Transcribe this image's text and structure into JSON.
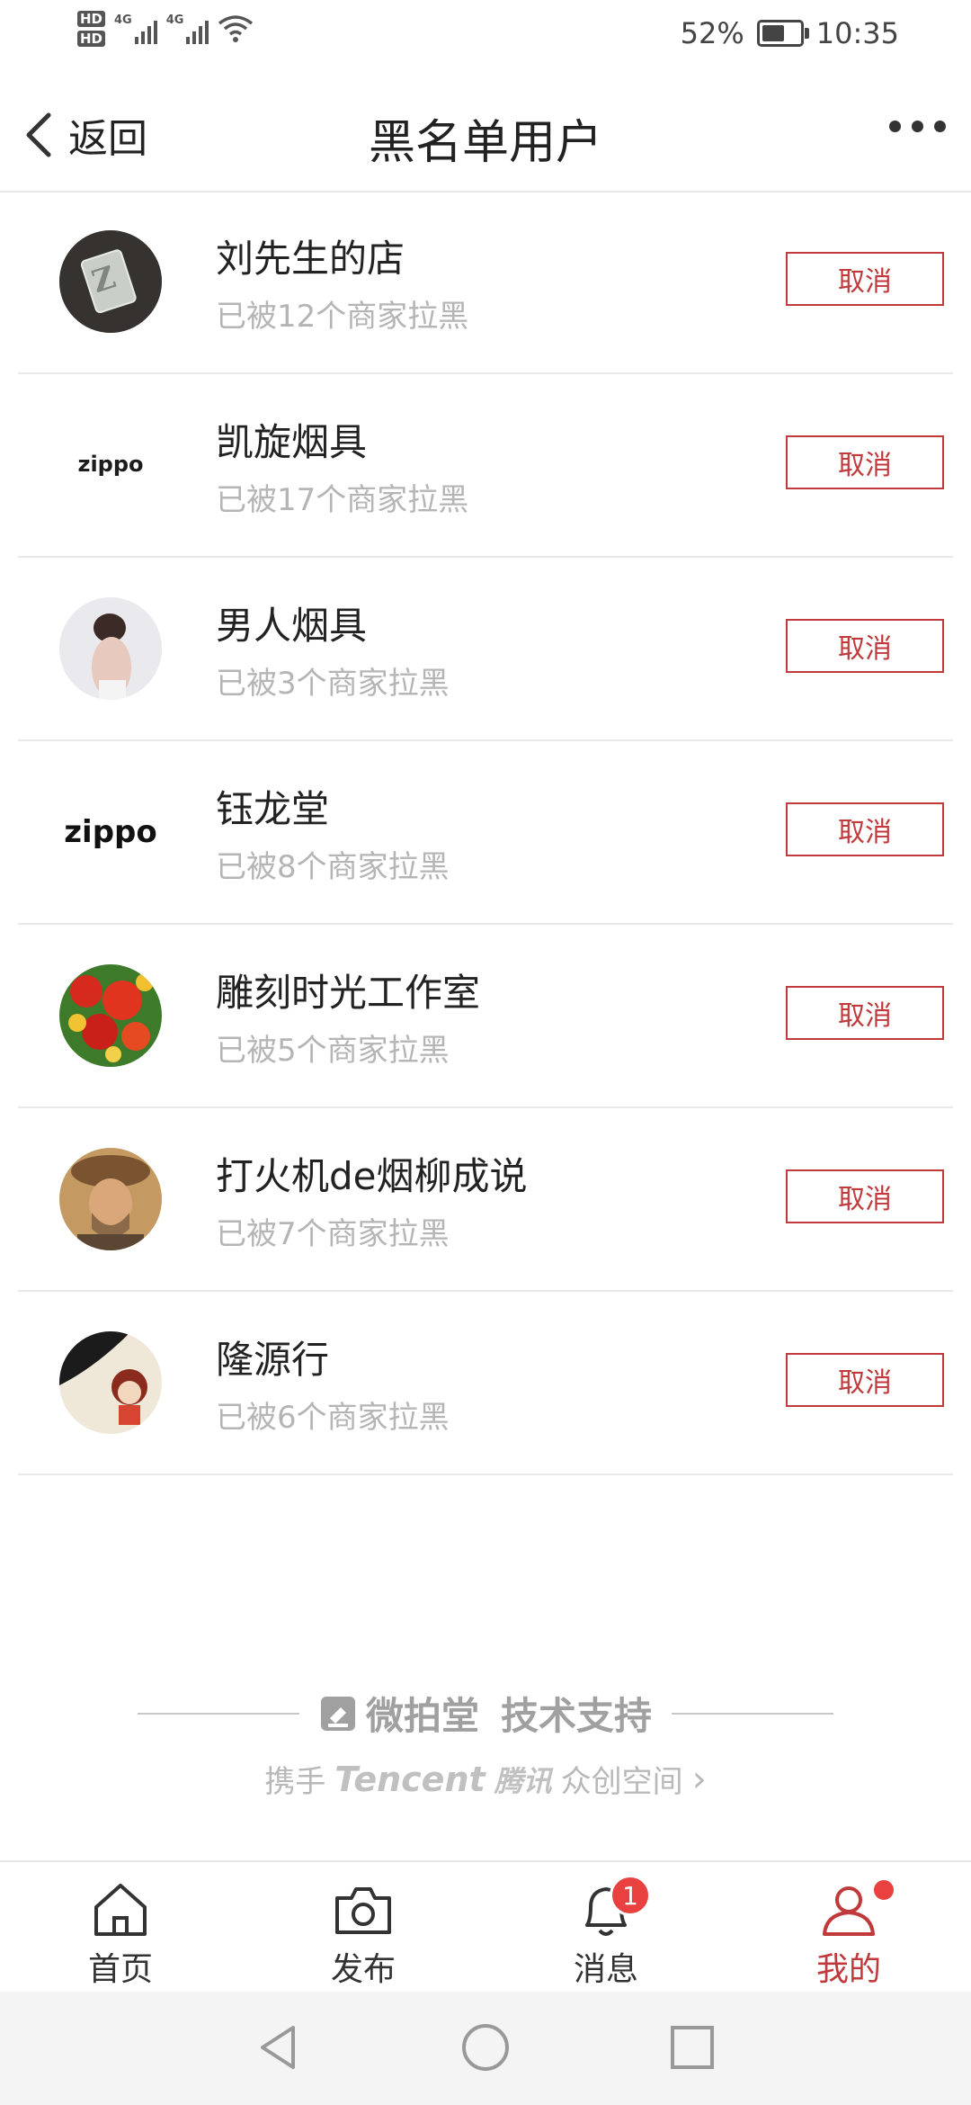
{
  "status_bar": {
    "hd1": "HD",
    "hd2": "HD",
    "net1": "4G",
    "net2": "4G",
    "battery_percent": "52%",
    "time": "10:35"
  },
  "header": {
    "back_label": "返回",
    "title": "黑名单用户"
  },
  "users": [
    {
      "name": "刘先生的店",
      "blocked_text": "已被12个商家拉黑",
      "action": "取消"
    },
    {
      "name": "凯旋烟具",
      "blocked_text": "已被17个商家拉黑",
      "action": "取消"
    },
    {
      "name": "男人烟具",
      "blocked_text": "已被3个商家拉黑",
      "action": "取消"
    },
    {
      "name": "钰龙堂",
      "blocked_text": "已被8个商家拉黑",
      "action": "取消"
    },
    {
      "name": "雕刻时光工作室",
      "blocked_text": "已被5个商家拉黑",
      "action": "取消"
    },
    {
      "name": "打火机de烟柳成说",
      "blocked_text": "已被7个商家拉黑",
      "action": "取消"
    },
    {
      "name": "隆源行",
      "blocked_text": "已被6个商家拉黑",
      "action": "取消"
    }
  ],
  "avatars": {
    "zippo_small": "zippo",
    "zippo_large": "zippo"
  },
  "credit": {
    "brand": "微拍堂",
    "support": "技术支持",
    "prefix": "携手",
    "tencent": "Tencent",
    "tencent_cn": "腾讯",
    "suffix": "众创空间",
    "chevron": "›"
  },
  "tabs": [
    {
      "label": "首页",
      "icon": "home-icon"
    },
    {
      "label": "发布",
      "icon": "camera-icon"
    },
    {
      "label": "消息",
      "icon": "bell-icon",
      "badge": "1"
    },
    {
      "label": "我的",
      "icon": "profile-icon",
      "active": true
    }
  ],
  "colors": {
    "accent": "#c0393b",
    "badge": "#e8413f",
    "muted_text": "#b5b5b5"
  }
}
